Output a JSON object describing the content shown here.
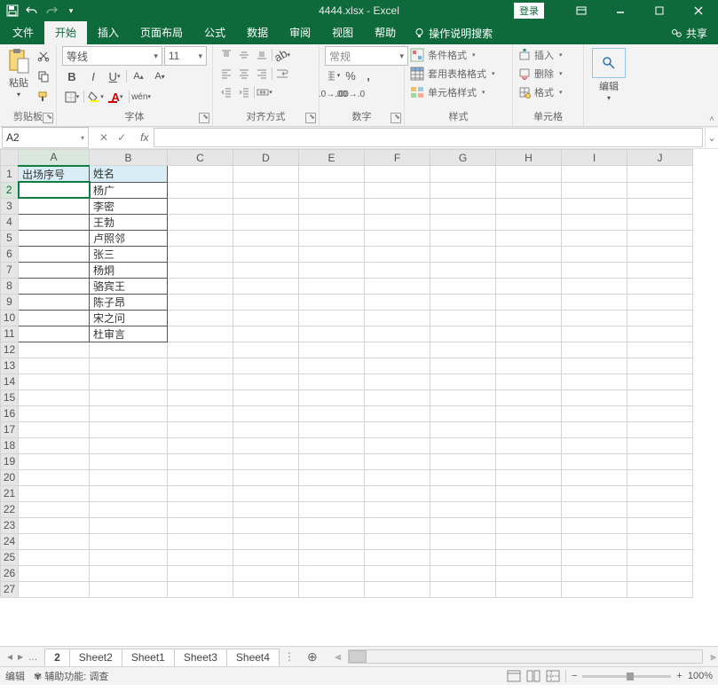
{
  "app": {
    "title_file": "4444.xlsx",
    "title_app": "Excel",
    "login": "登录"
  },
  "tabs": {
    "file": "文件",
    "home": "开始",
    "insert": "插入",
    "layout": "页面布局",
    "formulas": "公式",
    "data": "数据",
    "review": "审阅",
    "view": "视图",
    "help": "帮助",
    "tellme": "操作说明搜索",
    "share": "共享"
  },
  "ribbon": {
    "clipboard": {
      "paste": "粘贴",
      "label": "剪贴板"
    },
    "font": {
      "name": "等线",
      "size": "11",
      "label": "字体"
    },
    "align": {
      "label": "对齐方式"
    },
    "number": {
      "format": "常规",
      "label": "数字"
    },
    "styles": {
      "cond": "条件格式",
      "tablefmt": "套用表格格式",
      "cellstyle": "单元格样式",
      "label": "样式"
    },
    "cells": {
      "insert": "插入",
      "delete": "删除",
      "format": "格式",
      "label": "单元格"
    },
    "editing": {
      "label": "编辑"
    }
  },
  "namebox": "A2",
  "chart_data": {
    "type": "table",
    "columns": [
      "A",
      "B",
      "C",
      "D",
      "E",
      "F",
      "G",
      "H",
      "I",
      "J"
    ],
    "headers_row": [
      "出场序号",
      "姓名",
      "",
      "",
      "",
      "",
      "",
      "",
      "",
      ""
    ],
    "rows": [
      [
        "",
        "杨广",
        "",
        "",
        "",
        "",
        "",
        "",
        "",
        ""
      ],
      [
        "",
        "李密",
        "",
        "",
        "",
        "",
        "",
        "",
        "",
        ""
      ],
      [
        "",
        "王勃",
        "",
        "",
        "",
        "",
        "",
        "",
        "",
        ""
      ],
      [
        "",
        "卢照邻",
        "",
        "",
        "",
        "",
        "",
        "",
        "",
        ""
      ],
      [
        "",
        "张三",
        "",
        "",
        "",
        "",
        "",
        "",
        "",
        ""
      ],
      [
        "",
        "杨炯",
        "",
        "",
        "",
        "",
        "",
        "",
        "",
        ""
      ],
      [
        "",
        "骆宾王",
        "",
        "",
        "",
        "",
        "",
        "",
        "",
        ""
      ],
      [
        "",
        "陈子昂",
        "",
        "",
        "",
        "",
        "",
        "",
        "",
        ""
      ],
      [
        "",
        "宋之问",
        "",
        "",
        "",
        "",
        "",
        "",
        "",
        ""
      ],
      [
        "",
        "杜审言",
        "",
        "",
        "",
        "",
        "",
        "",
        "",
        ""
      ]
    ],
    "total_visible_rows": 27,
    "active_cell": "A2"
  },
  "sheets": {
    "list": [
      "2",
      "Sheet2",
      "Sheet1",
      "Sheet3",
      "Sheet4"
    ],
    "active": "2",
    "more": "..."
  },
  "status": {
    "mode": "编辑",
    "acc": "辅助功能: 调查",
    "zoom": "100%"
  }
}
